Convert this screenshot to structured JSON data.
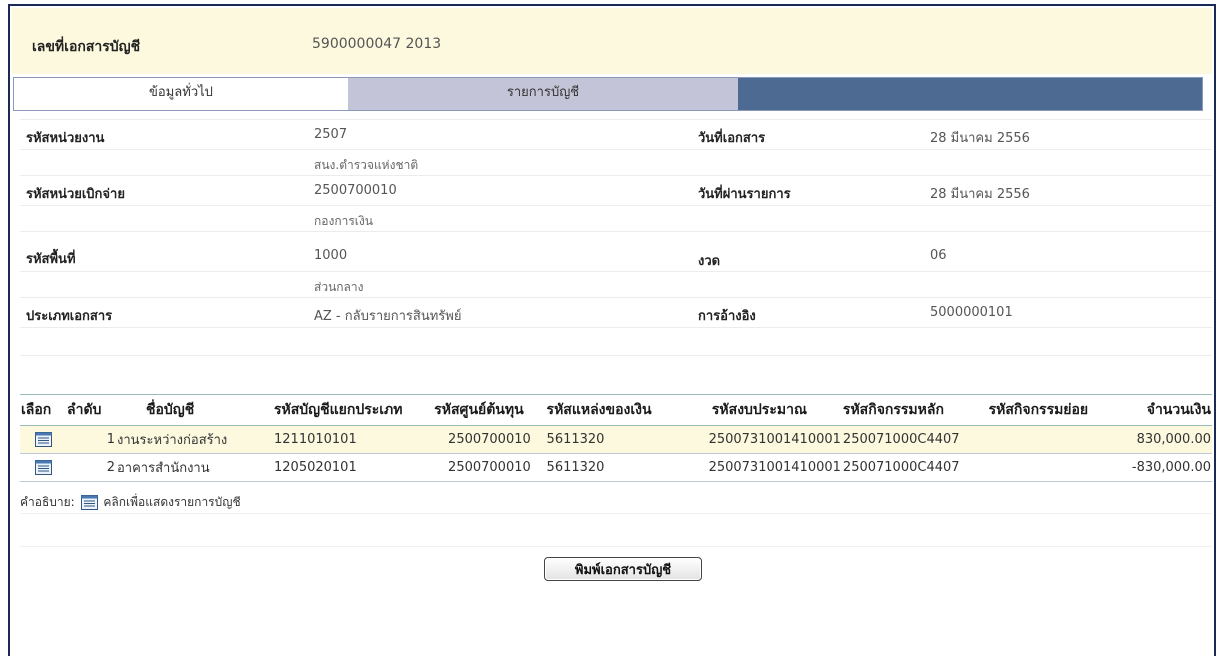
{
  "document": {
    "number_label": "เลขที่เอกสารบัญชี",
    "number_value": "5900000047  2013"
  },
  "tabs": [
    {
      "label": "ข้อมูลทั่วไป"
    },
    {
      "label": "รายการบัญชี"
    }
  ],
  "info": {
    "agency_code_label": "รหัสหน่วยงาน",
    "agency_code": "2507",
    "agency_name": "สนง.ตำรวจแห่งชาติ",
    "doc_date_label": "วันที่เอกสาร",
    "doc_date": "28 มีนาคม 2556",
    "disbursing_unit_label": "รหัสหน่วยเบิกจ่าย",
    "disbursing_unit_code": "2500700010",
    "disbursing_unit_name": "กองการเงิน",
    "posting_date_label": "วันที่ผ่านรายการ",
    "posting_date": "28 มีนาคม 2556",
    "area_code_label": "รหัสพื้นที่",
    "area_code": "1000",
    "area_name": "ส่วนกลาง",
    "period_label": "งวด",
    "period": "06",
    "doc_type_label": "ประเภทเอกสาร",
    "doc_type": "AZ - กลับรายการสินทรัพย์",
    "reference_label": "การอ้างอิง",
    "reference": "5000000101"
  },
  "table": {
    "headers": [
      "เลือก",
      "ลำดับ",
      "ชื่อบัญชี",
      "รหัสบัญชีแยกประเภท",
      "รหัสศูนย์ต้นทุน",
      "รหัสแหล่งของเงิน",
      "รหัสงบประมาณ",
      "รหัสกิจกรรมหลัก",
      "รหัสกิจกรรมย่อย",
      "จำนวนเงิน"
    ],
    "rows": [
      [
        "1",
        "งานระหว่างก่อสร้าง",
        "1211010101",
        "2500700010",
        "5611320",
        "2500731001410001",
        "250071000C4407",
        "",
        "830,000.00"
      ],
      [
        "2",
        "อาคารสำนักงาน",
        "1205020101",
        "2500700010",
        "5611320",
        "2500731001410001",
        "250071000C4407",
        "",
        "-830,000.00"
      ]
    ]
  },
  "legend": {
    "prefix": "คำอธิบาย:",
    "text": "คลิกเพื่อแสดงรายการบัญชี"
  },
  "print_button_label": "พิมพ์เอกสารบัญชี"
}
